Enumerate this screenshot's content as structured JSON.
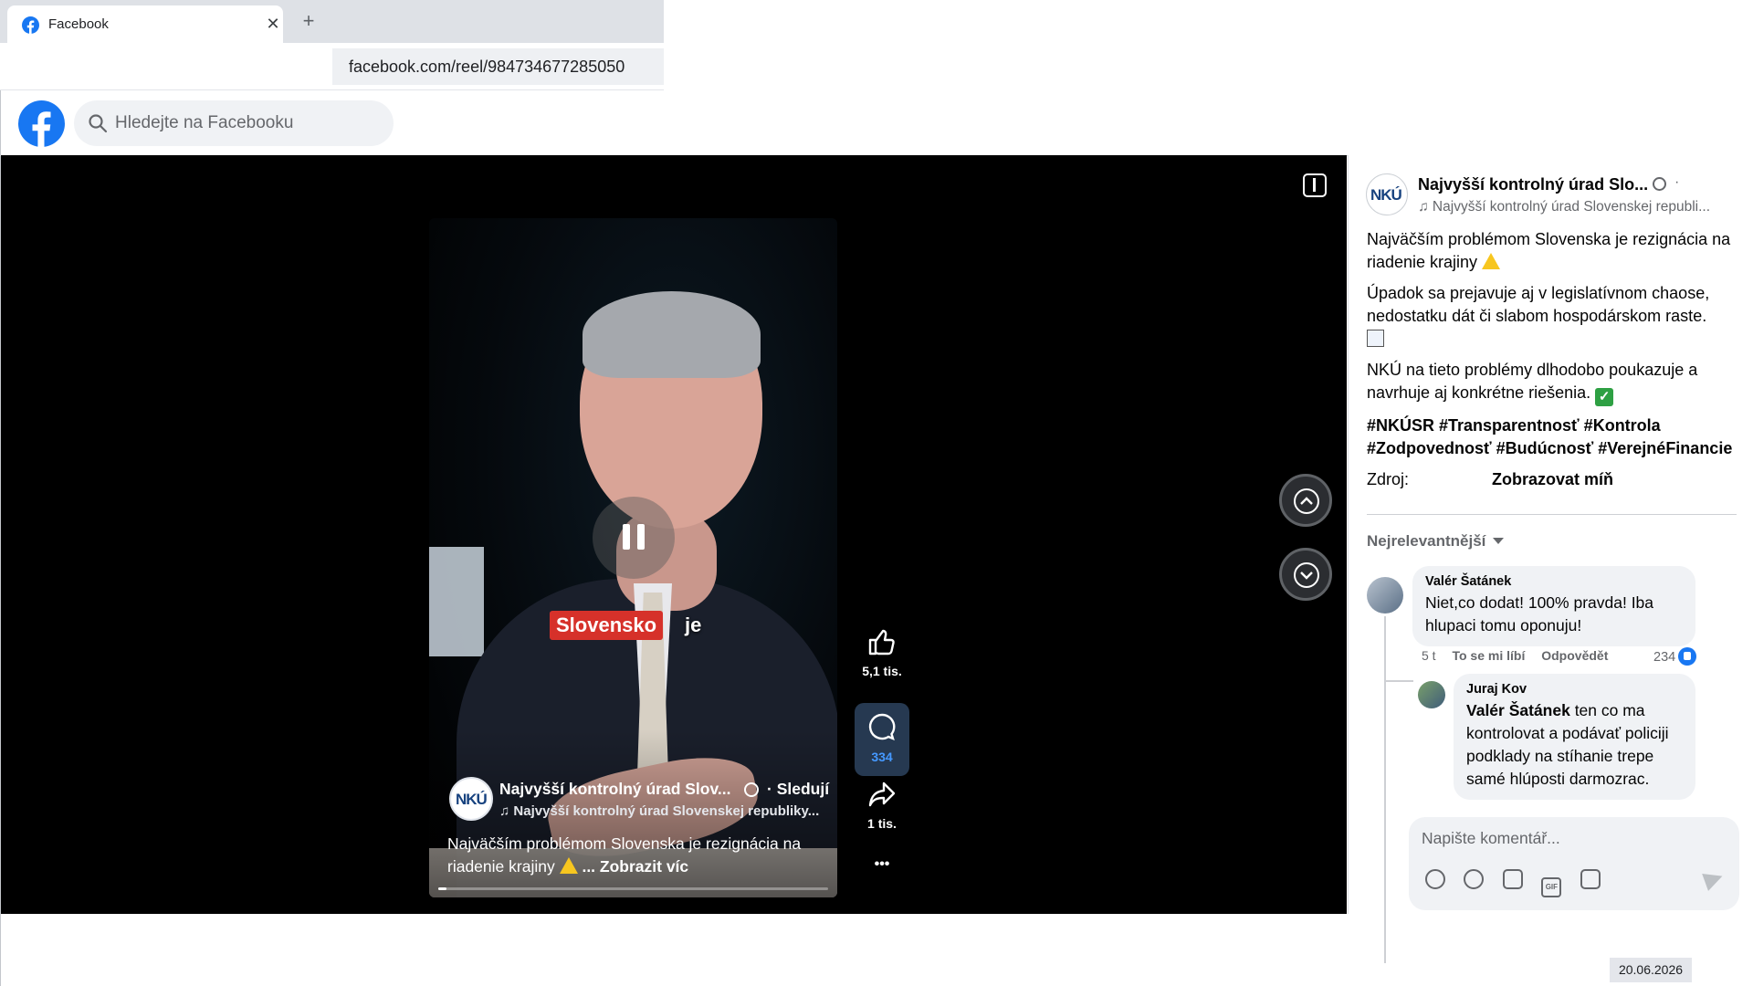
{
  "browser": {
    "tab_title": "Facebook",
    "tab_close_glyph": "✕",
    "new_tab_glyph": "+",
    "url": "facebook.com/reel/984734677285050"
  },
  "header": {
    "search_placeholder": "Hledejte na Facebooku"
  },
  "video": {
    "caption_highlight": "Slovensko",
    "caption_rest": "je",
    "page_name": "Najvyšší kontrolný úrad Slov...",
    "follow_label": "· Sledují",
    "audio_label": "♫ Najvyšší kontrolný úrad Slovenskej republiky...",
    "description": "Najväčším problémom Slovenska je rezignácia na riadenie krajiny",
    "see_more": "... Zobrazit víc",
    "avatar_text": "NKÚ",
    "progress_fraction": 0.02
  },
  "actions": {
    "likes": "5,1 tis.",
    "comments": "334",
    "shares": "1 tis.",
    "more_glyph": "•••"
  },
  "post": {
    "avatar_text": "NKÚ",
    "page_name": "Najvyšší kontrolný úrad Slo...",
    "dot": "·",
    "audio_label": "♫ Najvyšší kontrolný úrad Slovenskej republi...",
    "para1": "Najväčším problémom Slovenska je rezignácia na riadenie krajiny",
    "para2": "Úpadok sa prejavuje aj v legislatívnom chaose, nedostatku dát či slabom hospodárskom raste.",
    "para3": "NKÚ na tieto problémy dlhodobo poukazuje a navrhuje aj konkrétne riešenia.",
    "check_glyph": "✓",
    "hashtags": "#NKÚSR #Transparentnosť #Kontrola #Zodpovednosť #Budúcnosť #VerejnéFinancie",
    "source_label": "Zdroj:",
    "show_less": "Zobrazovat míň"
  },
  "comments": {
    "sort_label": "Nejrelevantnější",
    "items": [
      {
        "author": "Valér Šatánek",
        "text": "Niet,co dodat! 100% pravda! Iba hlupaci tomu oponuju!",
        "age": "5 t",
        "like_label": "To se mi líbí",
        "reply_label": "Odpovědět",
        "reaction_count": "234"
      },
      {
        "author": "Juraj Kov",
        "mention": "Valér Šatánek",
        "text": " ten co ma kontrolovat a podávať policiji podklady na stíhanie trepe samé hlúposti darmozrac."
      }
    ],
    "compose_placeholder": "Napište komentář..."
  },
  "footer": {
    "date": "20.06.2026"
  },
  "colors": {
    "facebook_blue": "#1877f2",
    "comment_active_bg": "#263951",
    "caption_red": "#d6312a"
  },
  "icons": [
    "facebook-logo-icon",
    "search-icon",
    "close-icon",
    "plus-icon",
    "pause-icon",
    "like-icon",
    "comment-icon",
    "share-icon",
    "more-icon",
    "globe-icon",
    "music-icon",
    "chevron-up-icon",
    "chevron-down-icon",
    "sidebar-toggle-icon",
    "avatar-icon",
    "emoji-icon",
    "camera-icon",
    "gif-icon",
    "sticker-icon",
    "send-icon"
  ]
}
